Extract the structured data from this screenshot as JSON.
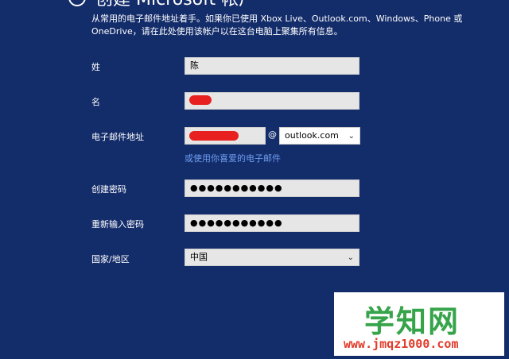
{
  "header": {
    "back_icon": "back-arrow-icon",
    "title": "创建 Microsoft 帐户"
  },
  "description": "从常用的电子邮件地址着手。如果你已使用 Xbox Live、Outlook.com、Windows、Phone 或 OneDrive，请在此处使用该帐户以在这台电脑上聚集所有信息。",
  "form": {
    "last_name": {
      "label": "姓",
      "value": "陈"
    },
    "first_name": {
      "label": "名",
      "value": ""
    },
    "email": {
      "label": "电子邮件地址",
      "value": "",
      "at": "@",
      "domain_selected": "outlook.com"
    },
    "alt_email_link": "或使用你喜爱的电子邮件",
    "password": {
      "label": "创建密码",
      "value": "●●●●●●●●●●●"
    },
    "confirm_password": {
      "label": "重新输入密码",
      "value": "●●●●●●●●●●●"
    },
    "country": {
      "label": "国家/地区",
      "selected": "中国"
    }
  },
  "watermark": {
    "main": "学知网",
    "sub": "www.jmqz1000.com"
  },
  "colors": {
    "background": "#132c6a",
    "link": "#6e9ef0",
    "redaction": "#e8201f"
  }
}
